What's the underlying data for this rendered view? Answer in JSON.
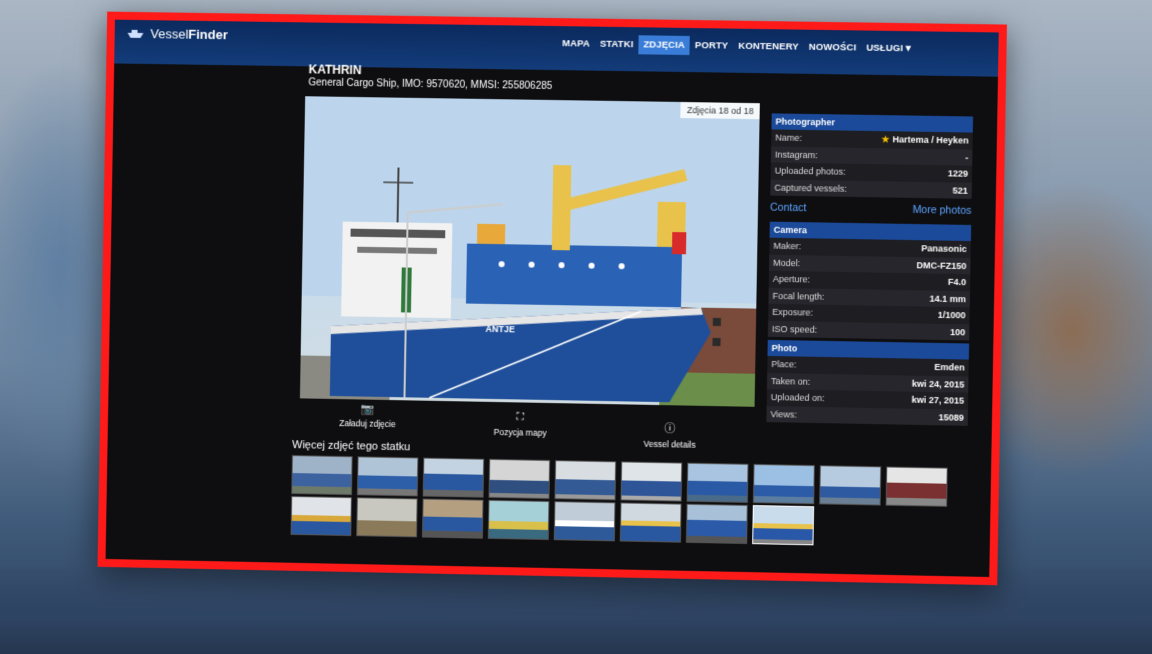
{
  "brand": {
    "logo_text_a": "Vessel",
    "logo_text_b": "Finder"
  },
  "nav": [
    {
      "label": "MAPA",
      "active": false
    },
    {
      "label": "STATKI",
      "active": false
    },
    {
      "label": "ZDJĘCIA",
      "active": true
    },
    {
      "label": "PORTY",
      "active": false
    },
    {
      "label": "KONTENERY",
      "active": false
    },
    {
      "label": "NOWOŚCI",
      "active": false
    },
    {
      "label": "USŁUGI ▾",
      "active": false
    }
  ],
  "vessel": {
    "name": "KATHRIN",
    "subtitle": "General Cargo Ship, IMO: 9570620, MMSI: 255806285",
    "hull_name": "ANTJE"
  },
  "photo": {
    "counter": "Zdjęcia 18 od 18"
  },
  "actions": [
    {
      "label": "Załaduj zdjęcie",
      "icon": "camera-icon"
    },
    {
      "label": "Pozycja mapy",
      "icon": "map-icon"
    },
    {
      "label": "Vessel details",
      "icon": "info-icon"
    }
  ],
  "more_photos_title": "Więcej zdjęć tego statku",
  "photographer": {
    "title": "Photographer",
    "rows": [
      {
        "k": "Name:",
        "v": "Hartema / Heyken"
      },
      {
        "k": "Instagram:",
        "v": "-"
      },
      {
        "k": "Uploaded photos:",
        "v": "1229"
      },
      {
        "k": "Captured vessels:",
        "v": "521"
      }
    ]
  },
  "links": {
    "contact": "Contact",
    "more": "More photos"
  },
  "camera": {
    "title": "Camera",
    "rows": [
      {
        "k": "Maker:",
        "v": "Panasonic"
      },
      {
        "k": "Model:",
        "v": "DMC-FZ150"
      },
      {
        "k": "Aperture:",
        "v": "F4.0"
      },
      {
        "k": "Focal length:",
        "v": "14.1 mm"
      },
      {
        "k": "Exposure:",
        "v": "1/1000"
      },
      {
        "k": "ISO speed:",
        "v": "100"
      }
    ]
  },
  "photo_info": {
    "title": "Photo",
    "rows": [
      {
        "k": "Place:",
        "v": "Emden"
      },
      {
        "k": "Taken on:",
        "v": "kwi 24, 2015"
      },
      {
        "k": "Uploaded on:",
        "v": "kwi 27, 2015"
      },
      {
        "k": "Views:",
        "v": "15089"
      }
    ]
  },
  "colors": {
    "frame": "#ff1a1a",
    "accent": "#3a7dd8",
    "panel_head": "#1b4a9a",
    "link": "#5da3ff"
  }
}
